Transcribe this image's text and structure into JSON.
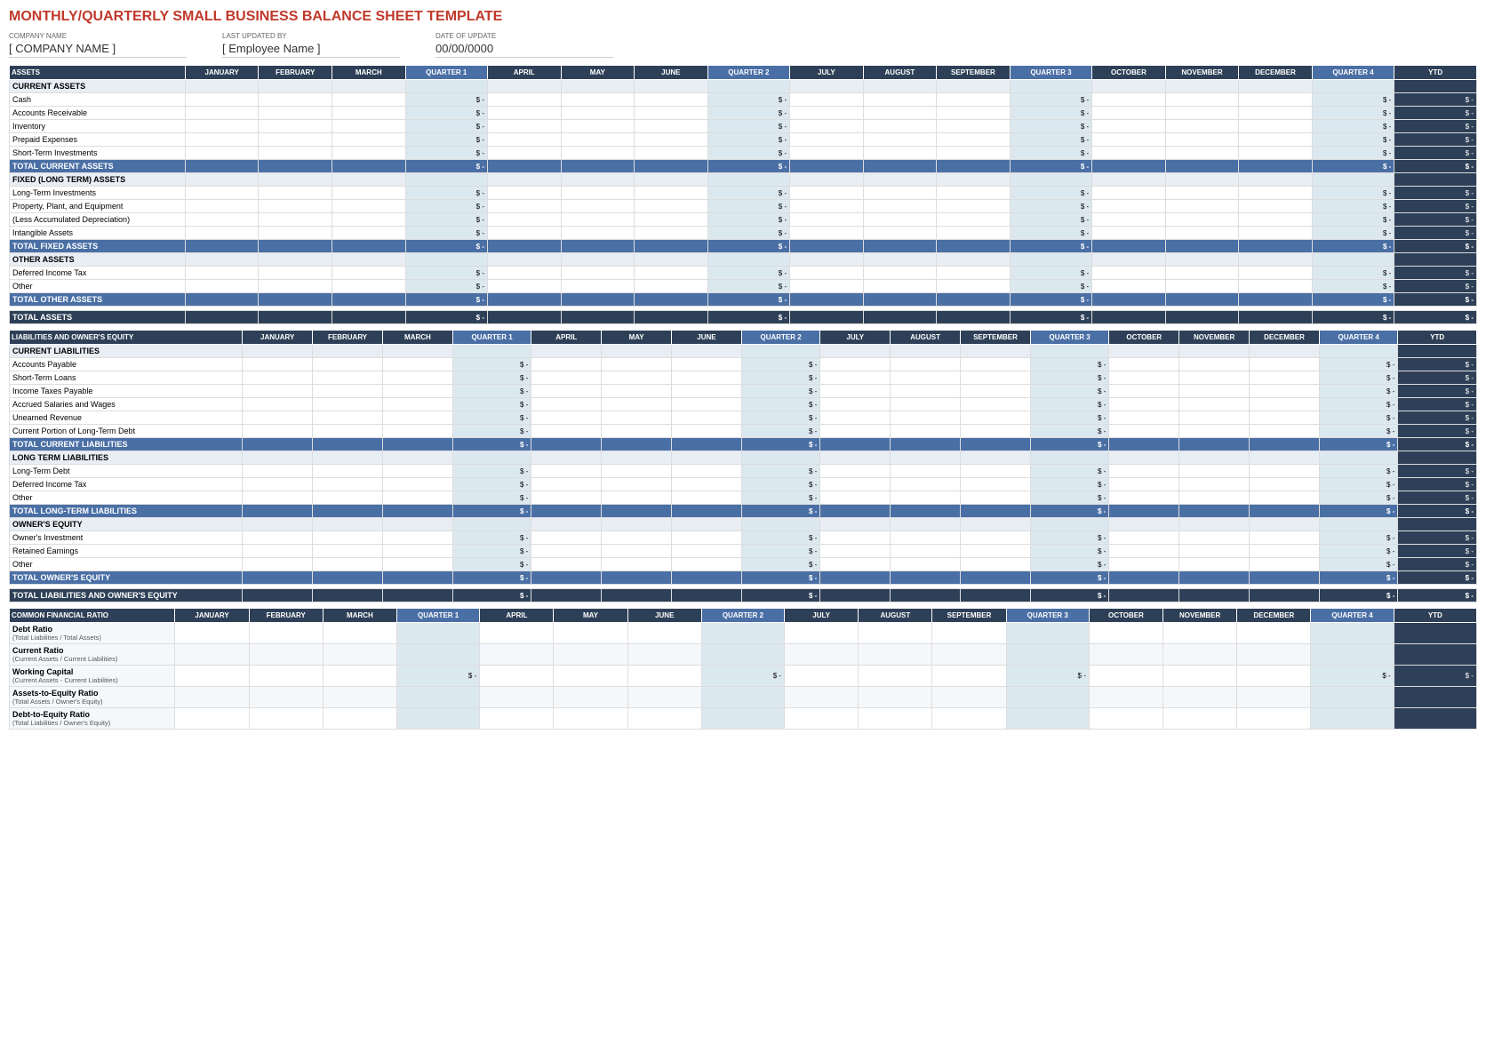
{
  "title": "MONTHLY/QUARTERLY SMALL BUSINESS BALANCE SHEET TEMPLATE",
  "meta": {
    "company_label": "COMPANY NAME",
    "company_value": "[ COMPANY NAME ]",
    "updated_label": "LAST UPDATED BY",
    "updated_value": "[ Employee Name ]",
    "date_label": "DATE OF UPDATE",
    "date_value": "00/00/0000"
  },
  "columns": {
    "label": "ASSETS",
    "months_q1": [
      "JANUARY",
      "FEBRUARY",
      "MARCH",
      "QUARTER 1"
    ],
    "months_q2": [
      "APRIL",
      "MAY",
      "JUNE",
      "QUARTER 2"
    ],
    "months_q3": [
      "JULY",
      "AUGUST",
      "SEPTEMBER",
      "QUARTER 3"
    ],
    "months_q4": [
      "OCTOBER",
      "NOVEMBER",
      "DECEMBER",
      "QUARTER 4"
    ],
    "ytd": "YTD"
  },
  "assets": {
    "section": "CURRENT ASSETS",
    "items": [
      "Cash",
      "Accounts Receivable",
      "Inventory",
      "Prepaid Expenses",
      "Short-Term Investments"
    ],
    "total_current": "TOTAL CURRENT ASSETS",
    "fixed_section": "FIXED (LONG TERM) ASSETS",
    "fixed_items": [
      "Long-Term Investments",
      "Property, Plant, and Equipment",
      "(Less Accumulated Depreciation)",
      "Intangible Assets"
    ],
    "total_fixed": "TOTAL FIXED ASSETS",
    "other_section": "OTHER ASSETS",
    "other_items": [
      "Deferred Income Tax",
      "Other"
    ],
    "total_other": "TOTAL OTHER ASSETS",
    "grand_total": "TOTAL ASSETS"
  },
  "liabilities": {
    "header_label": "LIABILITIES AND OWNER'S EQUITY",
    "current_section": "CURRENT LIABILITIES",
    "current_items": [
      "Accounts Payable",
      "Short-Term Loans",
      "Income Taxes Payable",
      "Accrued Salaries and Wages",
      "Unearned Revenue",
      "Current Portion of Long-Term Debt"
    ],
    "total_current": "TOTAL CURRENT LIABILITIES",
    "longterm_section": "LONG TERM LIABILITIES",
    "longterm_items": [
      "Long-Term Debt",
      "Deferred Income Tax",
      "Other"
    ],
    "total_longterm": "TOTAL LONG-TERM LIABILITIES",
    "equity_section": "OWNER'S EQUITY",
    "equity_items": [
      "Owner's Investment",
      "Retained Earnings",
      "Other"
    ],
    "total_equity": "TOTAL OWNER'S EQUITY",
    "grand_total": "TOTAL LIABILITIES AND OWNER'S EQUITY"
  },
  "ratios": {
    "header": "COMMON FINANCIAL RATIO",
    "items": [
      {
        "title": "Debt Ratio",
        "sub": "(Total Liabilities / Total Assets)"
      },
      {
        "title": "Current Ratio",
        "sub": "(Current Assets / Current Liabilities)"
      },
      {
        "title": "Working Capital",
        "sub": "(Current Assets - Current Liabilities)",
        "has_dollar": true
      },
      {
        "title": "Assets-to-Equity Ratio",
        "sub": "(Total Assets / Owner's Equity)"
      },
      {
        "title": "Debt-to-Equity Ratio",
        "sub": "(Total Liabilities / Owner's Equity)"
      }
    ]
  }
}
